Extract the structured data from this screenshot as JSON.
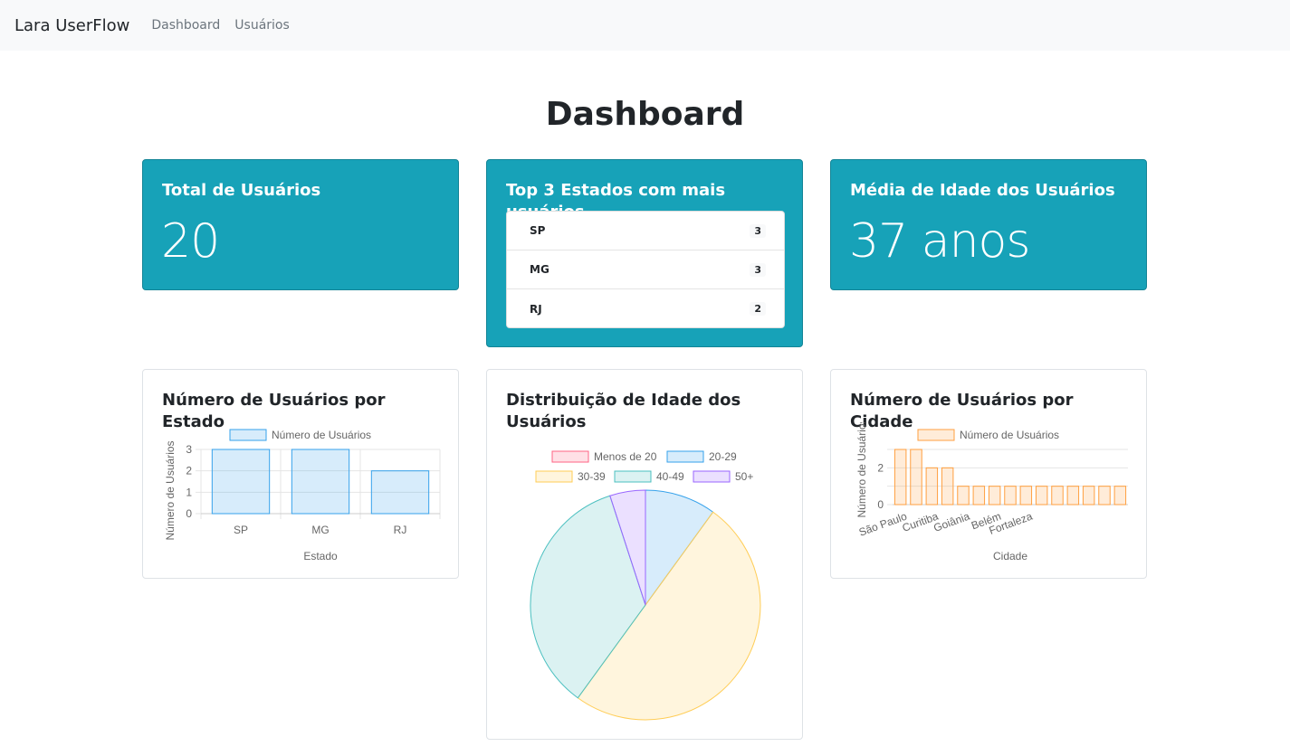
{
  "nav": {
    "brand": "Lara UserFlow",
    "links": [
      "Dashboard",
      "Usuários"
    ]
  },
  "page": {
    "title": "Dashboard"
  },
  "stats": {
    "total_users": {
      "title": "Total de Usuários",
      "value": "20"
    },
    "top_states": {
      "title": "Top 3 Estados com mais usuários",
      "items": [
        {
          "state": "SP",
          "count": "3"
        },
        {
          "state": "MG",
          "count": "3"
        },
        {
          "state": "RJ",
          "count": "2"
        }
      ]
    },
    "avg_age": {
      "title": "Média de Idade dos Usuários",
      "value": "37 anos"
    }
  },
  "chart_titles": {
    "by_state": "Número de Usuários por Estado",
    "age_dist": "Distribuição de Idade dos Usuários",
    "by_city": "Número de Usuários por Cidade"
  },
  "colors": {
    "accent": "#17a2b8",
    "blue": "#36a2eb",
    "pink": "#ff6384",
    "yellow": "#ffcd56",
    "teal": "#4bc0c0",
    "purple": "#9966ff",
    "orange": "#ff9f40"
  },
  "chart_data": [
    {
      "type": "bar",
      "title": "Número de Usuários por Estado",
      "categories": [
        "SP",
        "MG",
        "RJ"
      ],
      "series": [
        {
          "name": "Número de Usuários",
          "values": [
            3,
            3,
            2
          ]
        }
      ],
      "xlabel": "Estado",
      "ylabel": "Número de Usuários",
      "ylim": [
        0,
        3
      ],
      "yticks": [
        "0",
        "1",
        "2",
        "3"
      ],
      "grid": true,
      "legend": "top"
    },
    {
      "type": "pie",
      "title": "Distribuição de Idade dos Usuários",
      "categories": [
        "Menos de 20",
        "20-29",
        "30-39",
        "40-49",
        "50+"
      ],
      "values": [
        0,
        2,
        10,
        7,
        1
      ],
      "legend": "top"
    },
    {
      "type": "bar",
      "title": "Número de Usuários por Cidade",
      "categories": [
        "São Paulo",
        "",
        "Curitiba",
        "",
        "Goiânia",
        "",
        "Belém",
        "",
        "Fortaleza",
        "",
        "",
        "",
        "",
        "",
        ""
      ],
      "series": [
        {
          "name": "Número de Usuários",
          "values": [
            3,
            3,
            2,
            2,
            1,
            1,
            1,
            1,
            1,
            1,
            1,
            1,
            1,
            1,
            1
          ]
        }
      ],
      "xlabel": "Cidade",
      "ylabel": "Número de Usuários",
      "ylim": [
        0,
        3
      ],
      "yticks": [
        "0",
        "2"
      ],
      "grid": true,
      "legend": "top"
    }
  ]
}
